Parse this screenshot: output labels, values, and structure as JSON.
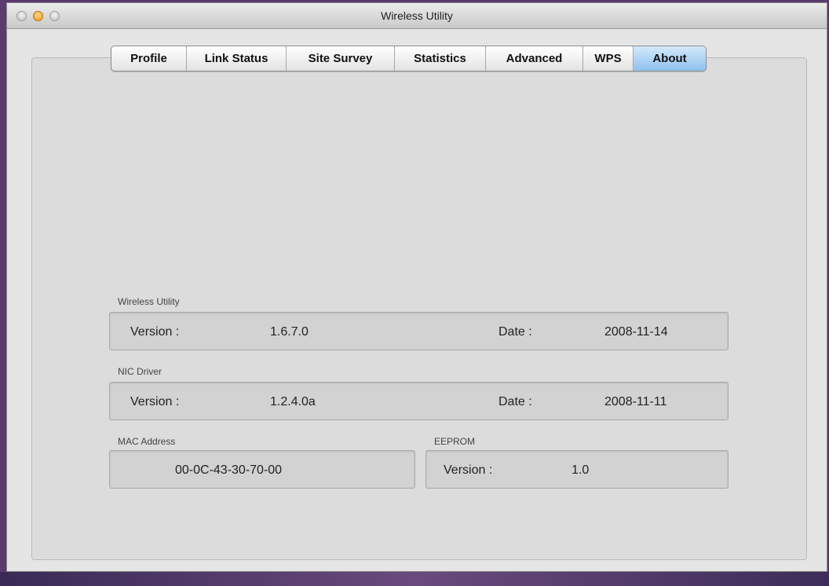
{
  "window": {
    "title": "Wireless Utility"
  },
  "tabs": [
    {
      "label": "Profile"
    },
    {
      "label": "Link Status"
    },
    {
      "label": "Site Survey"
    },
    {
      "label": "Statistics"
    },
    {
      "label": "Advanced"
    },
    {
      "label": "WPS"
    },
    {
      "label": "About"
    }
  ],
  "active_tab": "About",
  "wireless_utility": {
    "label": "Wireless Utility",
    "version_label": "Version :",
    "version": "1.6.7.0",
    "date_label": "Date :",
    "date": "2008-11-14"
  },
  "nic_driver": {
    "label": "NIC Driver",
    "version_label": "Version :",
    "version": "1.2.4.0a",
    "date_label": "Date :",
    "date": "2008-11-11"
  },
  "mac": {
    "label": "MAC Address",
    "value": "00-0C-43-30-70-00"
  },
  "eeprom": {
    "label": "EEPROM",
    "version_label": "Version :",
    "version": "1.0"
  },
  "colors": {
    "active_tab": "#8fc1ef",
    "minimize_button": "#f09a1a"
  }
}
